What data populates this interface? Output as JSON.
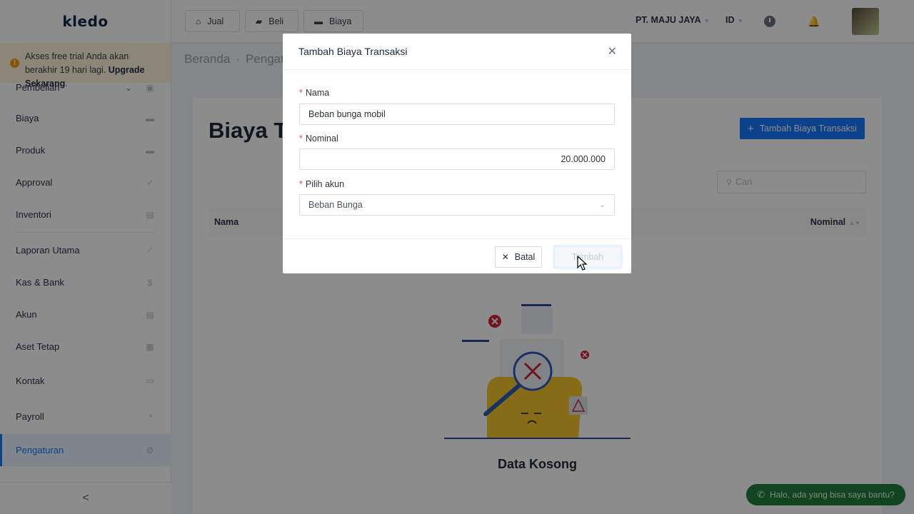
{
  "app": {
    "logo_text": "kledo"
  },
  "trial": {
    "message": "Akses free trial Anda akan berakhir 19 hari lagi.",
    "upgrade_link": "Upgrade Sekarang",
    "icon": "warning-icon"
  },
  "sidebar": {
    "items": [
      {
        "label": "Pembelian",
        "icon": "shopping-bag-icon",
        "has_caret": true
      },
      {
        "label": "Biaya",
        "icon": "card-icon"
      },
      {
        "label": "Produk",
        "icon": "box-icon"
      },
      {
        "label": "Approval",
        "icon": "check-icon"
      },
      {
        "label": "Inventori",
        "icon": "inventory-icon"
      },
      {
        "label": "Laporan Utama",
        "icon": "chart-icon"
      },
      {
        "label": "Kas & Bank",
        "icon": "dollar-icon"
      },
      {
        "label": "Akun",
        "icon": "ledger-icon"
      },
      {
        "label": "Aset Tetap",
        "icon": "building-icon"
      },
      {
        "label": "Kontak",
        "icon": "contact-card-icon"
      },
      {
        "label": "Payroll",
        "icon": "payroll-icon"
      },
      {
        "label": "Pengaturan",
        "icon": "gear-icon",
        "active": true
      }
    ],
    "collapse_symbol": "<"
  },
  "topbar": {
    "buttons": [
      {
        "label": "Jual",
        "icon": "basket-icon"
      },
      {
        "label": "Beli",
        "icon": "bag-icon"
      },
      {
        "label": "Biaya",
        "icon": "card-icon"
      }
    ],
    "company": "PT. MAJU JAYA",
    "language": "ID"
  },
  "breadcrumb": {
    "home": "Beranda",
    "current": "Pengatu"
  },
  "page": {
    "title": "Biaya Tr",
    "add_button": "Tambah Biaya Transaksi",
    "search_placeholder": "Cari",
    "columns": {
      "name": "Nama",
      "nominal": "Nominal"
    },
    "empty_text": "Data Kosong"
  },
  "modal": {
    "title": "Tambah Biaya Transaksi",
    "fields": {
      "nama": {
        "label": "Nama",
        "value": "Beban bunga mobil"
      },
      "nominal": {
        "label": "Nominal",
        "value": "20.000.000"
      },
      "akun": {
        "label": "Pilih akun",
        "value": "Beban Bunga"
      }
    },
    "cancel_label": "Batal",
    "submit_label": "Tambah"
  },
  "chat_widget": {
    "label": "Halo, ada yang bisa saya bantu?",
    "icon": "whatsapp-icon"
  },
  "colors": {
    "primary": "#1677ff",
    "whatsapp": "#1f7d3c",
    "required": "#ef4444",
    "trial_bg": "#fdf5db"
  }
}
